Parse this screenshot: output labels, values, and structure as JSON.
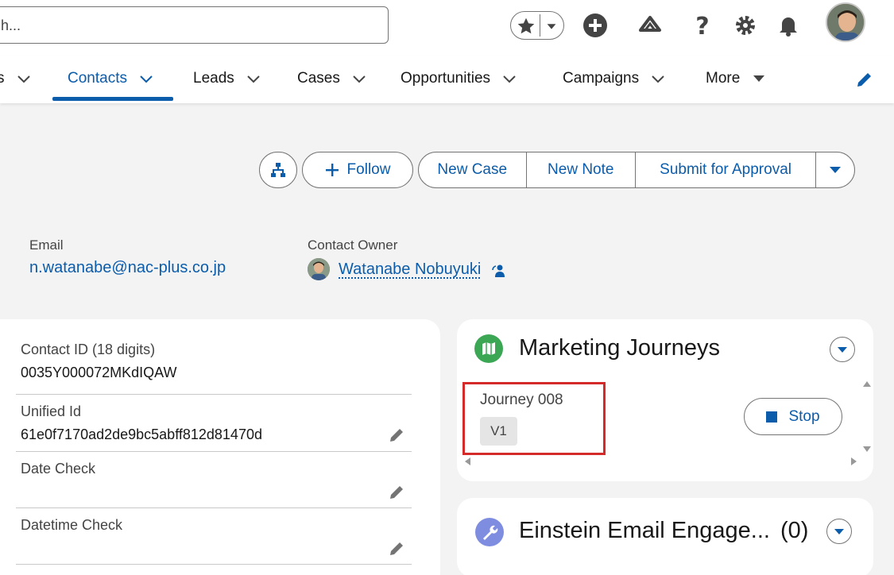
{
  "header": {
    "search_placeholder": "h..."
  },
  "nav": {
    "items": [
      {
        "label": "s"
      },
      {
        "label": "Contacts"
      },
      {
        "label": "Leads"
      },
      {
        "label": "Cases"
      },
      {
        "label": "Opportunities"
      },
      {
        "label": "Campaigns"
      },
      {
        "label": "More"
      }
    ]
  },
  "actions": {
    "follow": "Follow",
    "new_case": "New Case",
    "new_note": "New Note",
    "submit_approval": "Submit for Approval"
  },
  "highlights": {
    "email_label": "Email",
    "email_value": "n.watanabe@nac-plus.co.jp",
    "owner_label": "Contact Owner",
    "owner_value": "Watanabe Nobuyuki"
  },
  "details": {
    "fields": [
      {
        "label": "Contact ID (18 digits)",
        "value": "0035Y000072MKdIQAW"
      },
      {
        "label": "Unified Id",
        "value": "61e0f7170ad2de9bc5abff812d81470d"
      },
      {
        "label": "Date Check",
        "value": ""
      },
      {
        "label": "Datetime Check",
        "value": ""
      }
    ]
  },
  "marketing_journeys": {
    "title": "Marketing Journeys",
    "journey_name": "Journey 008",
    "version": "V1",
    "stop_label": "Stop"
  },
  "einstein": {
    "title": "Einstein Email Engage...",
    "count": "(0)"
  },
  "colors": {
    "brand_blue": "#0b5cab",
    "highlight_red": "#d42a2a",
    "journey_green": "#3ba755",
    "einstein_purple": "#7f8de1"
  }
}
